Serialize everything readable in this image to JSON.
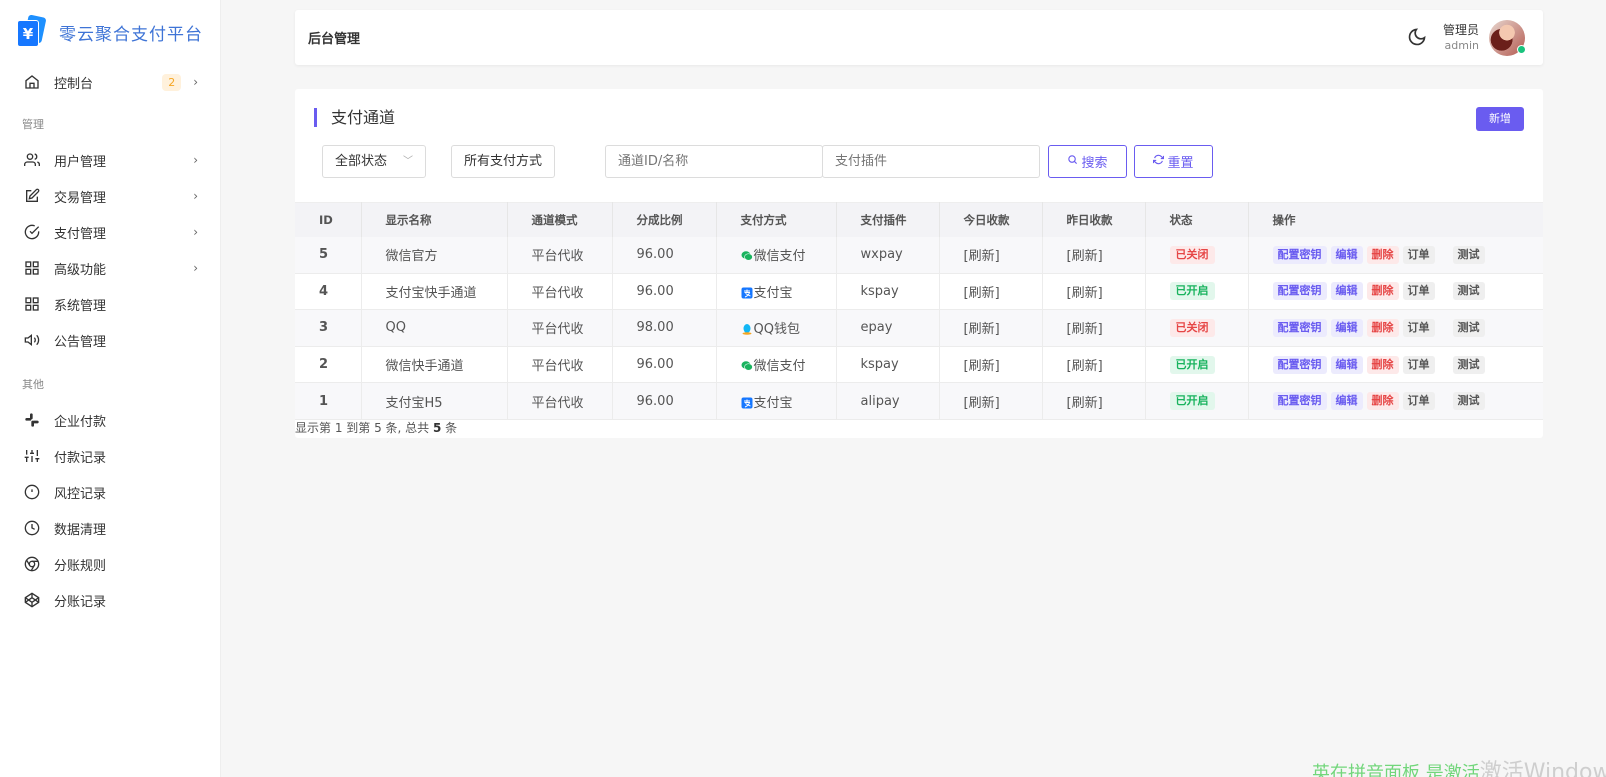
{
  "brand": {
    "title": "零云聚合支付平台",
    "logo_symbol": "¥"
  },
  "sidebar": {
    "top_items": [
      {
        "label": "控制台",
        "icon": "home-icon",
        "badge": "2"
      }
    ],
    "group_manage": "管理",
    "manage_items": [
      {
        "label": "用户管理",
        "icon": "users-icon"
      },
      {
        "label": "交易管理",
        "icon": "edit-icon"
      },
      {
        "label": "支付管理",
        "icon": "check-circle-icon"
      },
      {
        "label": "高级功能",
        "icon": "grid-icon"
      },
      {
        "label": "系统管理",
        "icon": "grid-icon"
      },
      {
        "label": "公告管理",
        "icon": "speaker-icon"
      }
    ],
    "group_other": "其他",
    "other_items": [
      {
        "label": "企业付款",
        "icon": "slack-icon"
      },
      {
        "label": "付款记录",
        "icon": "sliders-icon"
      },
      {
        "label": "风控记录",
        "icon": "alert-circle-icon"
      },
      {
        "label": "数据清理",
        "icon": "clock-icon"
      },
      {
        "label": "分账规则",
        "icon": "chrome-icon"
      },
      {
        "label": "分账记录",
        "icon": "codepen-icon"
      }
    ]
  },
  "header": {
    "title": "后台管理",
    "user_role": "管理员",
    "user_name": "admin"
  },
  "card": {
    "title": "支付通道",
    "new_button": "新增"
  },
  "filters": {
    "status": "全部状态",
    "method": "所有支付方式",
    "channel_placeholder": "通道ID/名称",
    "plugin_placeholder": "支付插件",
    "search_button": "搜索",
    "reset_button": "重置"
  },
  "table": {
    "columns": [
      "ID",
      "显示名称",
      "通道模式",
      "分成比例",
      "支付方式",
      "支付插件",
      "今日收款",
      "昨日收款",
      "状态",
      "操作"
    ],
    "actions": {
      "key": "配置密钥",
      "edit": "编辑",
      "delete": "删除",
      "order": "订单",
      "test": "测试"
    },
    "rows": [
      {
        "id": "5",
        "name": "微信官方",
        "mode": "平台代收",
        "rate": "96.00",
        "method": "微信支付",
        "method_icon": "wechat-icon",
        "plugin": "wxpay",
        "today": "[刷新]",
        "yesterday": "[刷新]",
        "status": "已关闭",
        "status_type": "closed"
      },
      {
        "id": "4",
        "name": "支付宝快手通道",
        "mode": "平台代收",
        "rate": "96.00",
        "method": "支付宝",
        "method_icon": "alipay-icon",
        "plugin": "kspay",
        "today": "[刷新]",
        "yesterday": "[刷新]",
        "status": "已开启",
        "status_type": "open"
      },
      {
        "id": "3",
        "name": "QQ",
        "mode": "平台代收",
        "rate": "98.00",
        "method": "QQ钱包",
        "method_icon": "qq-icon",
        "plugin": "epay",
        "today": "[刷新]",
        "yesterday": "[刷新]",
        "status": "已关闭",
        "status_type": "closed"
      },
      {
        "id": "2",
        "name": "微信快手通道",
        "mode": "平台代收",
        "rate": "96.00",
        "method": "微信支付",
        "method_icon": "wechat-icon",
        "plugin": "kspay",
        "today": "[刷新]",
        "yesterday": "[刷新]",
        "status": "已开启",
        "status_type": "open"
      },
      {
        "id": "1",
        "name": "支付宝H5",
        "mode": "平台代收",
        "rate": "96.00",
        "method": "支付宝",
        "method_icon": "alipay-icon",
        "plugin": "alipay",
        "today": "[刷新]",
        "yesterday": "[刷新]",
        "status": "已开启",
        "status_type": "open"
      }
    ]
  },
  "pager": {
    "prefix": "显示第 1 到第 5 条, 总共 ",
    "total": "5",
    "suffix": " 条"
  },
  "watermark": {
    "text_green": "英在拼音面板 是激活",
    "text": "激活Windows"
  },
  "colors": {
    "accent": "#6a5cf0",
    "brand": "#3f74d6",
    "closed": "#e64646",
    "open": "#19b35e"
  }
}
